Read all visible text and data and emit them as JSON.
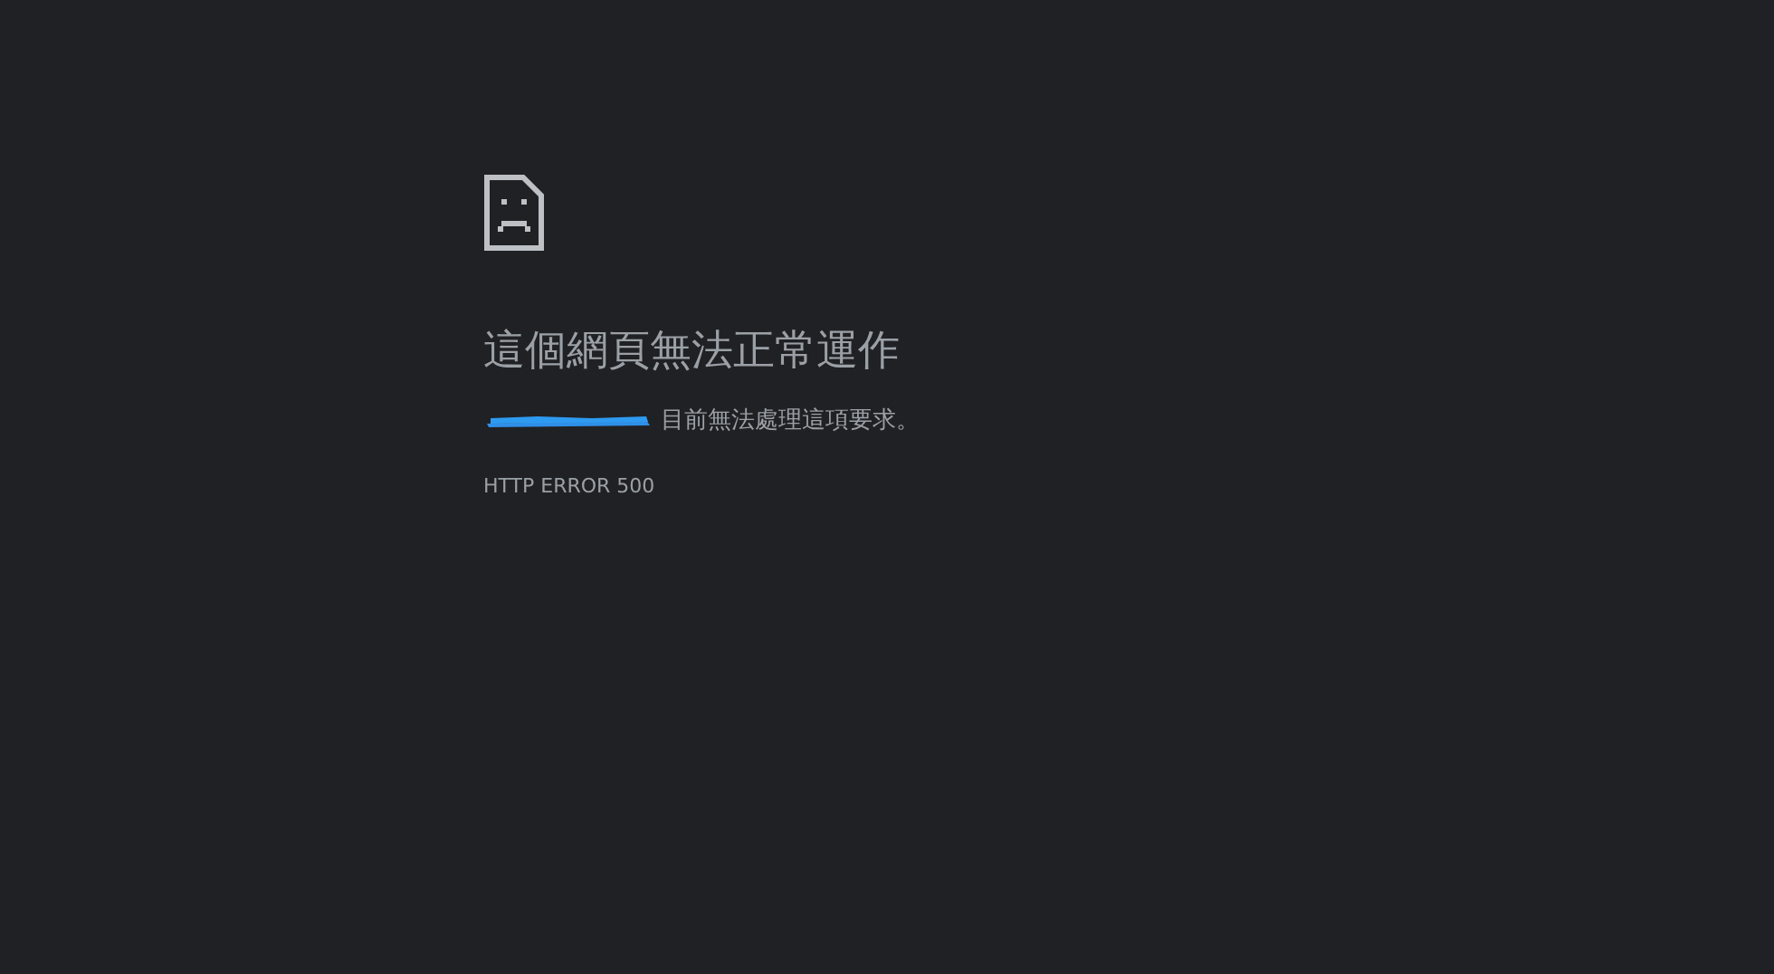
{
  "heading": "這個網頁無法正常運作",
  "message": {
    "redacted_host": true,
    "text": "目前無法處理這項要求。"
  },
  "error_code": "HTTP ERROR 500"
}
